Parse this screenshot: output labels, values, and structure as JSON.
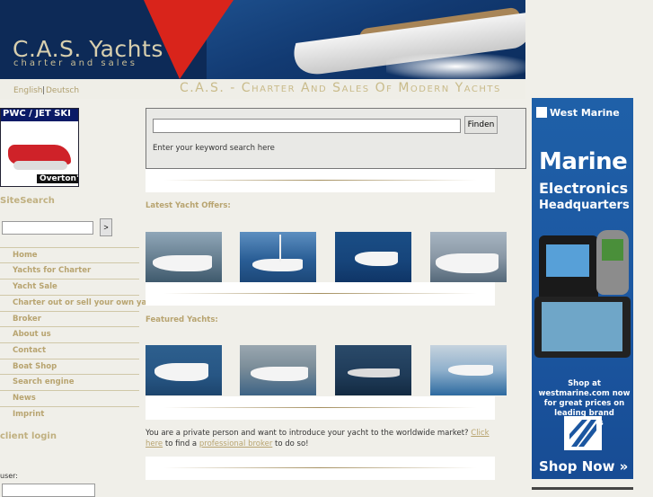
{
  "header": {
    "logo_title": "C.A.S. Yachts",
    "logo_subtitle": "charter and sales",
    "tagline": "C.A.S. - Charter And Sales Of Modern Yachts"
  },
  "languages": {
    "english": "English",
    "separator": "|",
    "german": "Deutsch"
  },
  "left_banner": {
    "title": "PWC / JET SKI",
    "brand": "Overton's"
  },
  "site_search": {
    "title": "SiteSearch",
    "button": ">"
  },
  "nav": {
    "items": [
      {
        "label": "Home"
      },
      {
        "label": "Yachts for Charter"
      },
      {
        "label": "Yacht Sale"
      },
      {
        "label": "Charter out or sell your own yacht"
      },
      {
        "label": "Broker"
      },
      {
        "label": "About us"
      },
      {
        "label": "Contact"
      },
      {
        "label": "Boat Shop"
      },
      {
        "label": "Search engine"
      },
      {
        "label": "News"
      },
      {
        "label": "Imprint"
      }
    ]
  },
  "client_login": {
    "title": "client login",
    "user_label": "user:"
  },
  "main_search": {
    "button": "Finden",
    "hint": "Enter your keyword search here"
  },
  "latest": {
    "title": "Latest Yacht Offers:"
  },
  "featured": {
    "title": "Featured Yachts:"
  },
  "promo": {
    "text_before": "You are a private person and want to introduce your yacht to the worldwide market?",
    "link1": "Click here",
    "text_mid": "to find a",
    "link2": "professional broker",
    "text_after": "to do so!"
  },
  "ad": {
    "brand": "West Marine",
    "headline1": "Marine",
    "headline2": "Electronics",
    "headline3": "Headquarters",
    "body": "Shop at westmarine.com now for great prices on leading brand products",
    "cta": "Shop Now »"
  },
  "colors": {
    "accent": "#b8a470",
    "header_bg": "#0d2a57",
    "ad_bg": "#1b56a0"
  }
}
